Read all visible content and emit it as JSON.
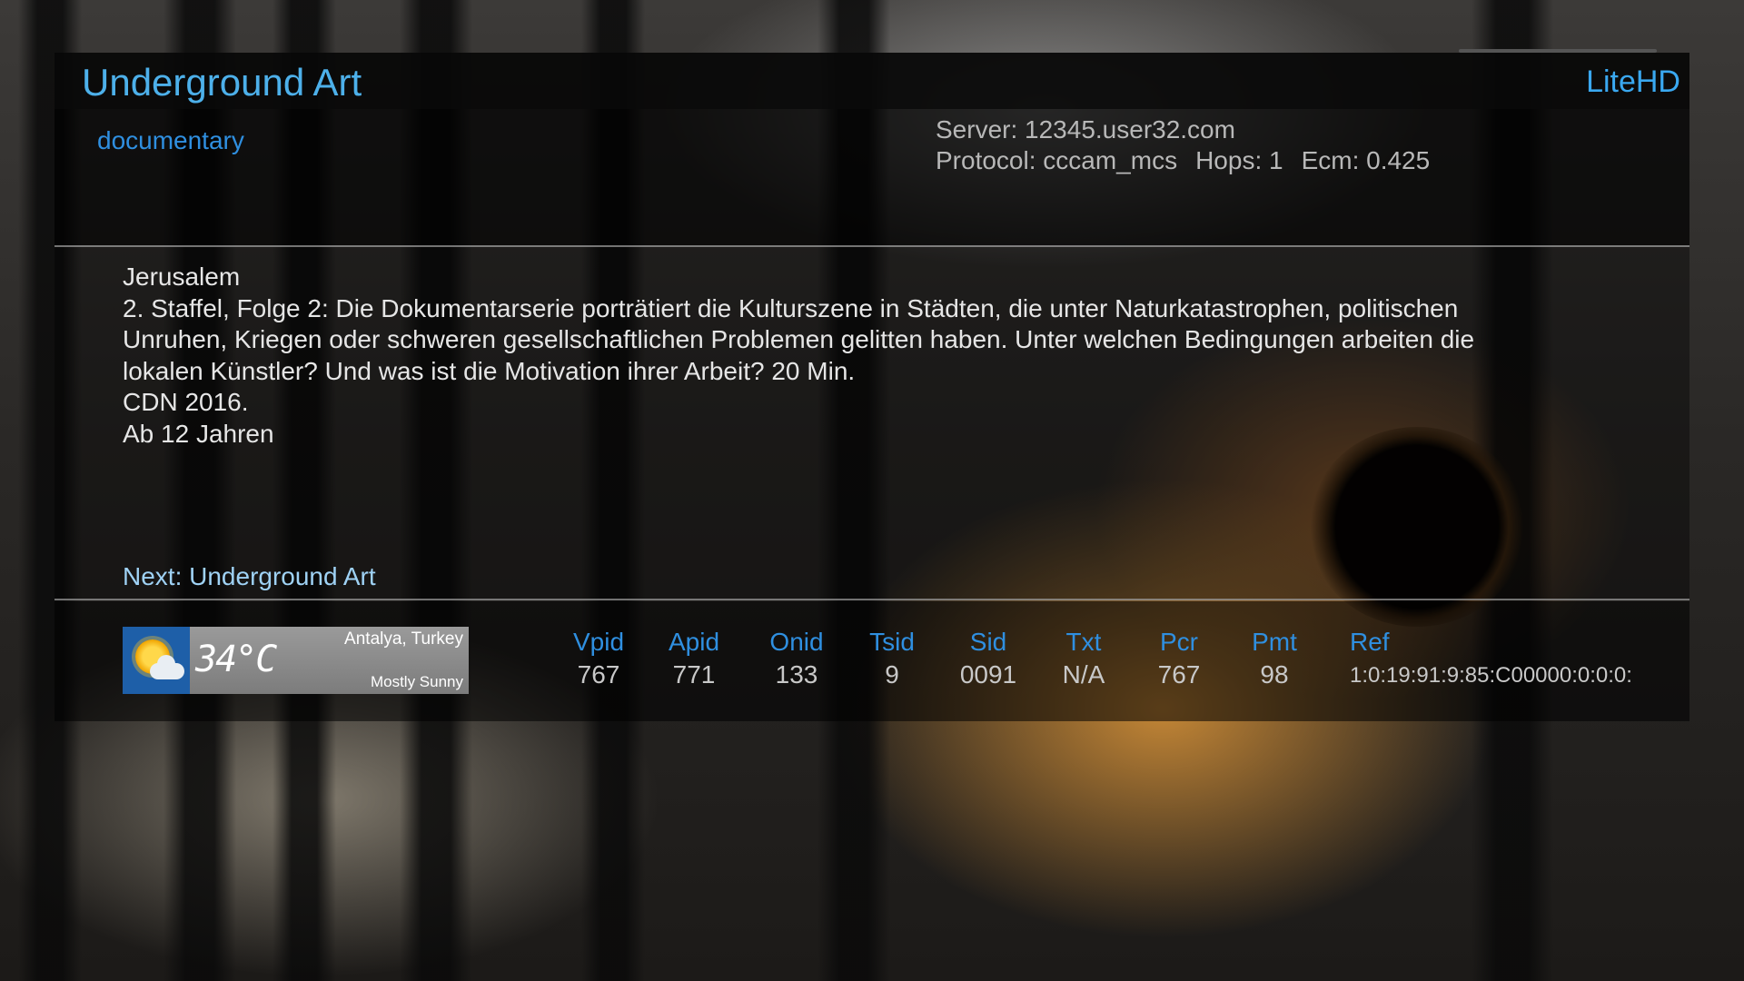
{
  "header": {
    "title": "Underground Art",
    "brand": "LiteHD"
  },
  "info": {
    "genre": "documentary",
    "server": "Server: 12345.user32.com",
    "protocol": "Protocol: cccam_mcs",
    "hops": "Hops: 1",
    "ecm": "Ecm: 0.425"
  },
  "description": {
    "lines": [
      "Jerusalem",
      "2. Staffel, Folge 2: Die Dokumentarserie porträtiert die Kulturszene in Städten, die unter Naturkatastrophen, politischen",
      "Unruhen, Kriegen oder schweren gesellschaftlichen Problemen gelitten haben. Unter welchen Bedingungen arbeiten die",
      "lokalen Künstler? Und was ist die Motivation ihrer Arbeit? 20 Min.",
      "CDN 2016.",
      "Ab 12 Jahren"
    ],
    "next": "Next: Underground Art"
  },
  "weather": {
    "icon": "sun-cloud-icon",
    "temperature": "34°C",
    "location": "Antalya, Turkey",
    "condition": "Mostly Sunny"
  },
  "pids": [
    {
      "label": "Vpid",
      "value": "767"
    },
    {
      "label": "Apid",
      "value": "771"
    },
    {
      "label": "Onid",
      "value": "133"
    },
    {
      "label": "Tsid",
      "value": "9"
    },
    {
      "label": "Sid",
      "value": "0091"
    },
    {
      "label": "Txt",
      "value": "N/A"
    },
    {
      "label": "Pcr",
      "value": "767"
    },
    {
      "label": "Pmt",
      "value": "98"
    }
  ],
  "ref": {
    "label": "Ref",
    "value": "1:0:19:91:9:85:C00000:0:0:0:"
  },
  "colors": {
    "title": "#4db0ea",
    "label_blue": "#2f8fe0",
    "text": "#e6e6e6"
  }
}
